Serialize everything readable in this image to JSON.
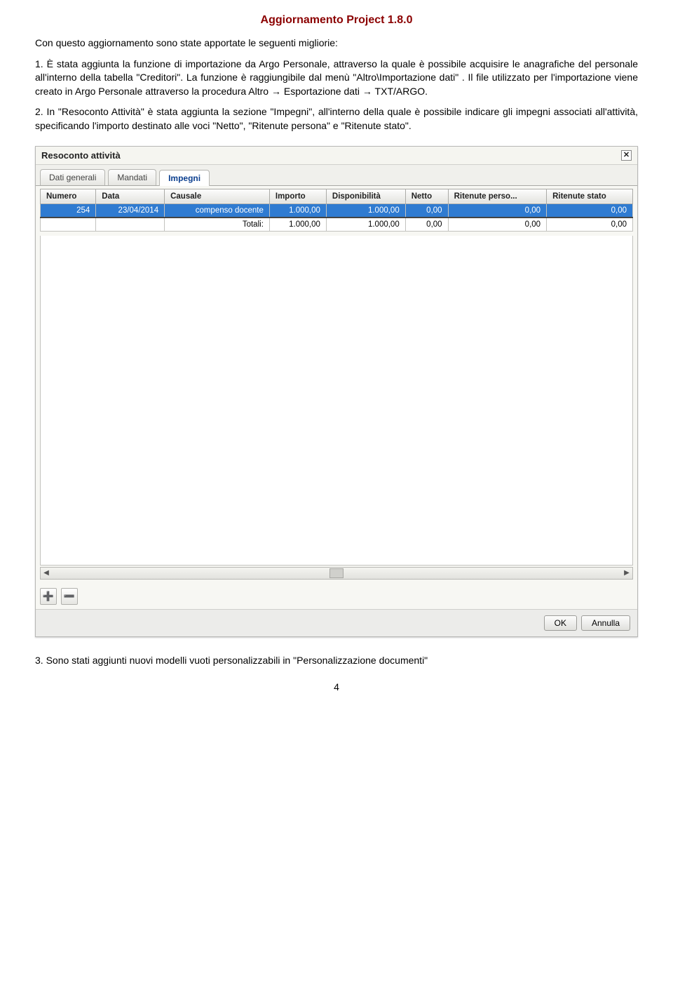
{
  "title": "Aggiornamento Project 1.8.0",
  "intro": "Con questo aggiornamento sono state apportate le seguenti migliorie:",
  "item1": "1. È stata aggiunta la funzione di importazione da Argo Personale, attraverso la quale è possibile acquisire le anagrafiche del personale all'interno della tabella \"Creditori\". La funzione è raggiungibile dal menù \"Altro\\Importazione dati\" . Il file utilizzato per l'importazione viene creato in Argo Personale attraverso la procedura Altro → Esportazione dati → TXT/ARGO.",
  "item2": "2. In \"Resoconto Attività\" è stata aggiunta la sezione \"Impegni\", all'interno della quale è possibile  indicare gli impegni associati all'attività, specificando l'importo destinato alle voci \"Netto\", \"Ritenute persona\" e \"Ritenute stato\".",
  "item3": "3. Sono stati aggiunti nuovi modelli vuoti personalizzabili in \"Personalizzazione documenti\"",
  "dialog": {
    "title": "Resoconto attività",
    "close_glyph": "✕",
    "tabs": [
      "Dati generali",
      "Mandati",
      "Impegni"
    ],
    "columns": [
      "Numero",
      "Data",
      "Causale",
      "Importo",
      "Disponibilità",
      "Netto",
      "Ritenute perso...",
      "Ritenute stato"
    ],
    "row": {
      "numero": "254",
      "data": "23/04/2014",
      "causale": "compenso docente",
      "importo": "1.000,00",
      "disponibilita": "1.000,00",
      "netto": "0,00",
      "rit_perso": "0,00",
      "rit_stato": "0,00"
    },
    "totals": {
      "label": "Totali:",
      "importo": "1.000,00",
      "disponibilita": "1.000,00",
      "netto": "0,00",
      "rit_perso": "0,00",
      "rit_stato": "0,00"
    },
    "ok": "OK",
    "cancel": "Annulla",
    "icon_add_glyph": "➕",
    "icon_del_glyph": "➖",
    "scroll_left": "◀",
    "scroll_right": "▶"
  },
  "page_number": "4"
}
